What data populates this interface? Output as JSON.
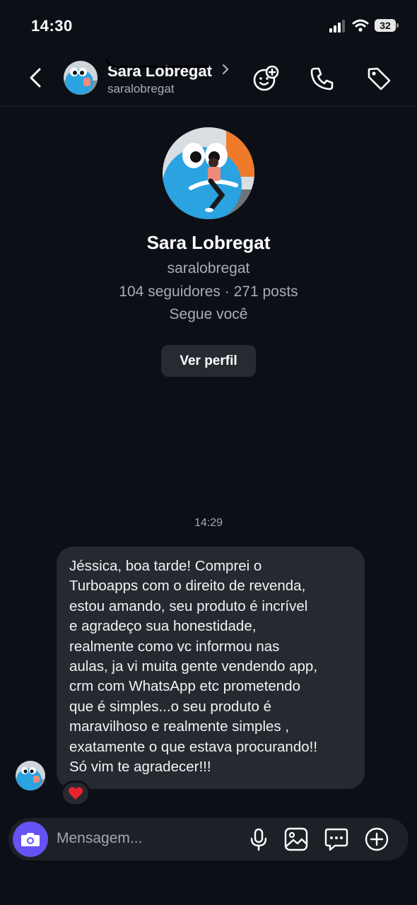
{
  "status_bar": {
    "time": "14:30",
    "battery": "32"
  },
  "header": {
    "contact_name": "Sara Lobregat",
    "contact_username": "saralobregat",
    "icons": [
      "back-arrow-icon",
      "chevron-right-icon",
      "add-sticker-icon",
      "phone-icon",
      "tag-icon"
    ]
  },
  "profile": {
    "name": "Sara Lobregat",
    "username": "saralobregat",
    "stats": "104 seguidores · 271 posts",
    "follows_status": "Segue você",
    "view_profile_label": "Ver perfil"
  },
  "conversation": {
    "timestamp": "14:29",
    "message": "Jéssica,  boa tarde! Comprei o\nTurboapps com o direito de revenda,\nestou amando,  seu produto é incrível\ne agradeço sua honestidade,\nrealmente como vc informou nas\naulas, ja vi muita gente vendendo app,\ncrm com WhatsApp etc prometendo\nque é simples...o seu produto é\nmaravilhoso e realmente simples ,\nexatamente o que estava procurando!!\nSó vim te agradecer!!!",
    "reaction": "❤️"
  },
  "composer": {
    "placeholder": "Mensagem...",
    "icons": [
      "camera-icon",
      "microphone-icon",
      "gallery-icon",
      "chat-bubble-icon",
      "plus-circle-icon"
    ]
  },
  "colors": {
    "background": "#0c1016",
    "bubble": "#262a30",
    "camera_button": "#6553f5",
    "secondary_text": "#a8aeb5"
  }
}
